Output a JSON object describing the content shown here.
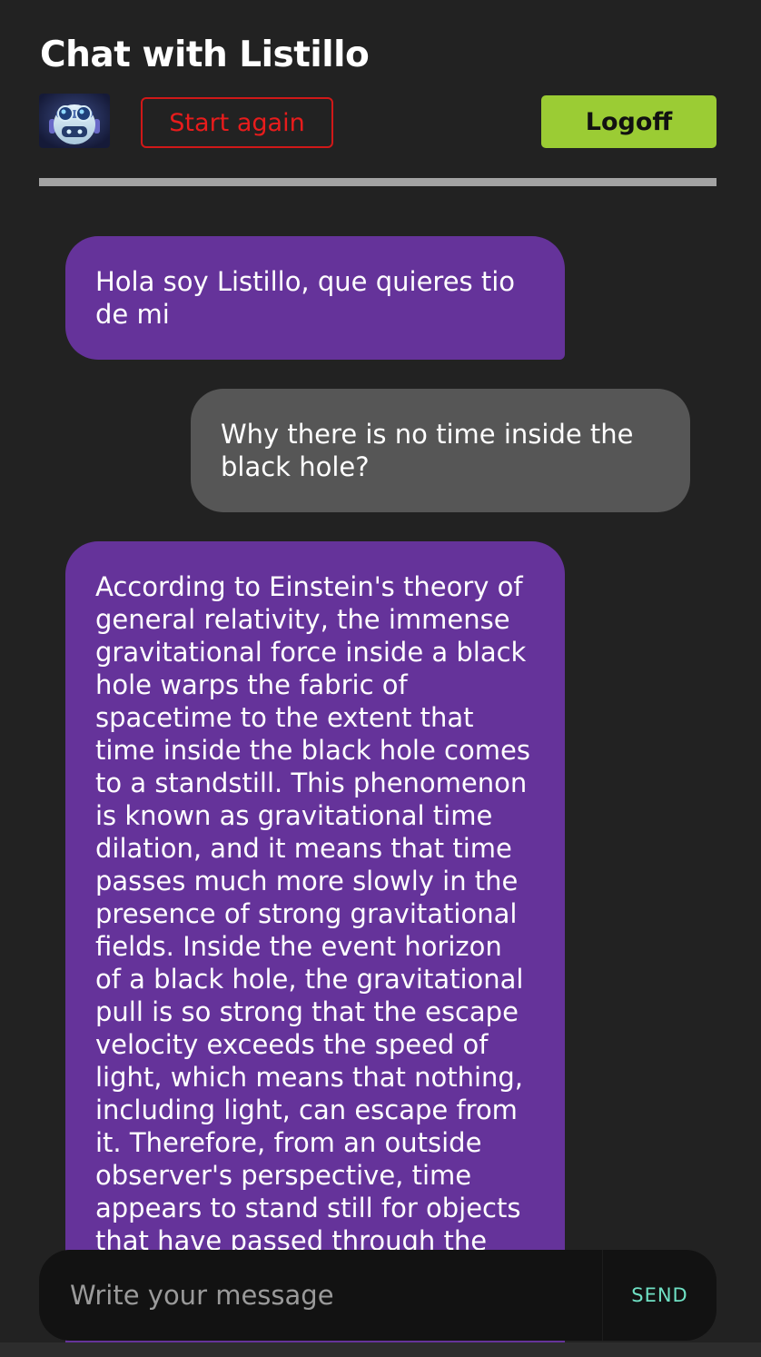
{
  "header": {
    "title": "Chat with Listillo",
    "restart_label": "Start again",
    "logoff_label": "Logoff"
  },
  "messages": [
    {
      "role": "bot",
      "text": "Hola soy Listillo, que quieres tio de mi"
    },
    {
      "role": "user",
      "text": "Why there is no time inside the black hole?"
    },
    {
      "role": "bot",
      "text": "According to Einstein's theory of general relativity, the immense gravitational force inside a black hole warps the fabric of spacetime to the extent that time inside the black hole comes to a standstill. This phenomenon is known as gravitational time dilation, and it means that time passes much more slowly in the presence of strong gravitational fields. Inside the event horizon of a black hole, the gravitational pull is so strong that the escape velocity exceeds the speed of light, which means that nothing, including light, can escape from it. Therefore, from an outside observer's perspective, time appears to stand still for objects that have passed through the"
    }
  ],
  "composer": {
    "placeholder": "Write your message",
    "send_label": "SEND"
  },
  "colors": {
    "background": "#222222",
    "bot_bubble": "#65339a",
    "user_bubble": "#565656",
    "restart_accent": "#d01818",
    "logoff_accent": "#9bcc34",
    "send_accent": "#6fe0c4"
  },
  "icons": {
    "avatar": "robot-avatar-icon"
  }
}
